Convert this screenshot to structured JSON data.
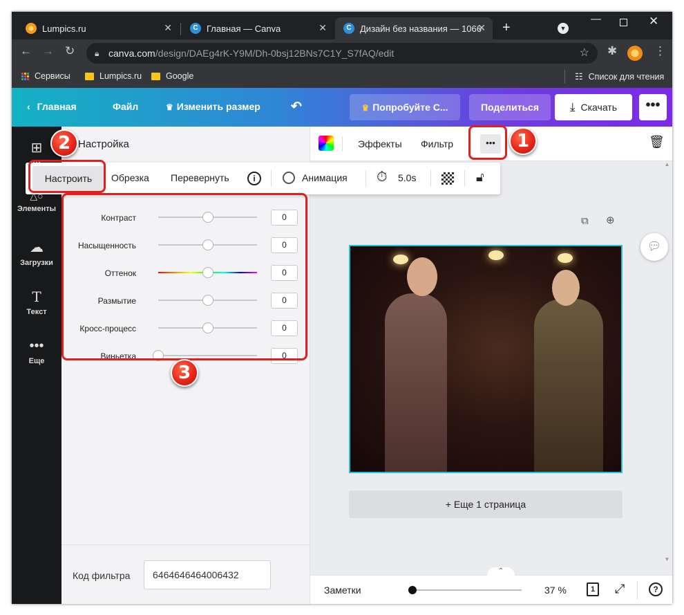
{
  "browser": {
    "tabs": [
      {
        "title": "Lumpics.ru",
        "icon": "lumpics-favicon"
      },
      {
        "title": "Главная — Canva",
        "icon": "canva-favicon"
      },
      {
        "title": "Дизайн без названия — 1066",
        "icon": "canva-favicon",
        "active": true
      }
    ],
    "url_host": "canva.com",
    "url_path": "/design/DAEg4rK-Y9M/Dh-0bsj12BNs7C1Y_S7fAQ/edit",
    "bookmarks": [
      {
        "label": "Сервисы",
        "icon": "apps-grid-icon"
      },
      {
        "label": "Lumpics.ru",
        "icon": "folder-icon"
      },
      {
        "label": "Google",
        "icon": "folder-icon"
      }
    ],
    "reading_list": "Список для чтения"
  },
  "canva_header": {
    "home": "Главная",
    "file": "Файл",
    "resize": "Изменить размер",
    "try_pro": "Попробуйте С...",
    "share": "Поделиться",
    "download": "Скачать"
  },
  "sidebar": {
    "items": [
      {
        "label": "Ш",
        "icon": "templates-icon"
      },
      {
        "label": "Элементы",
        "icon": "elements-icon"
      },
      {
        "label": "Загрузки",
        "icon": "upload-cloud-icon"
      },
      {
        "label": "Текст",
        "icon": "text-icon"
      },
      {
        "label": "Еще",
        "icon": "more-dots-icon"
      }
    ]
  },
  "panel": {
    "title": "Настройка",
    "sliders": [
      {
        "label": "Контраст",
        "value": "0",
        "position": 0.5
      },
      {
        "label": "Насыщенность",
        "value": "0",
        "position": 0.5
      },
      {
        "label": "Оттенок",
        "value": "0",
        "position": 0.5
      },
      {
        "label": "Размытие",
        "value": "0",
        "position": 0.5
      },
      {
        "label": "Кросс-процесс",
        "value": "0",
        "position": 0.5
      },
      {
        "label": "Виньетка",
        "value": "0",
        "position": 0.0
      }
    ],
    "filter_code_label": "Код фильтра",
    "filter_code_value": "6464646464006432"
  },
  "editor_toolbar": {
    "effects": "Эффекты",
    "filter": "Фильтр"
  },
  "float_toolbar": {
    "adjust": "Настроить",
    "crop": "Обрезка",
    "flip": "Перевернуть",
    "animation": "Анимация",
    "duration": "5.0s"
  },
  "canvas": {
    "add_page": "+ Еще 1 страница"
  },
  "bottom_bar": {
    "notes": "Заметки",
    "zoom": "37 %",
    "page_num": "1",
    "zoom_slider_position": 0.0
  },
  "callouts": [
    "1",
    "2",
    "3"
  ],
  "colors": {
    "accent_red": "#e0201f",
    "canva_teal": "#14b2c4",
    "canva_purple": "#7d2ae8",
    "selection_teal": "#1fc4d6"
  }
}
